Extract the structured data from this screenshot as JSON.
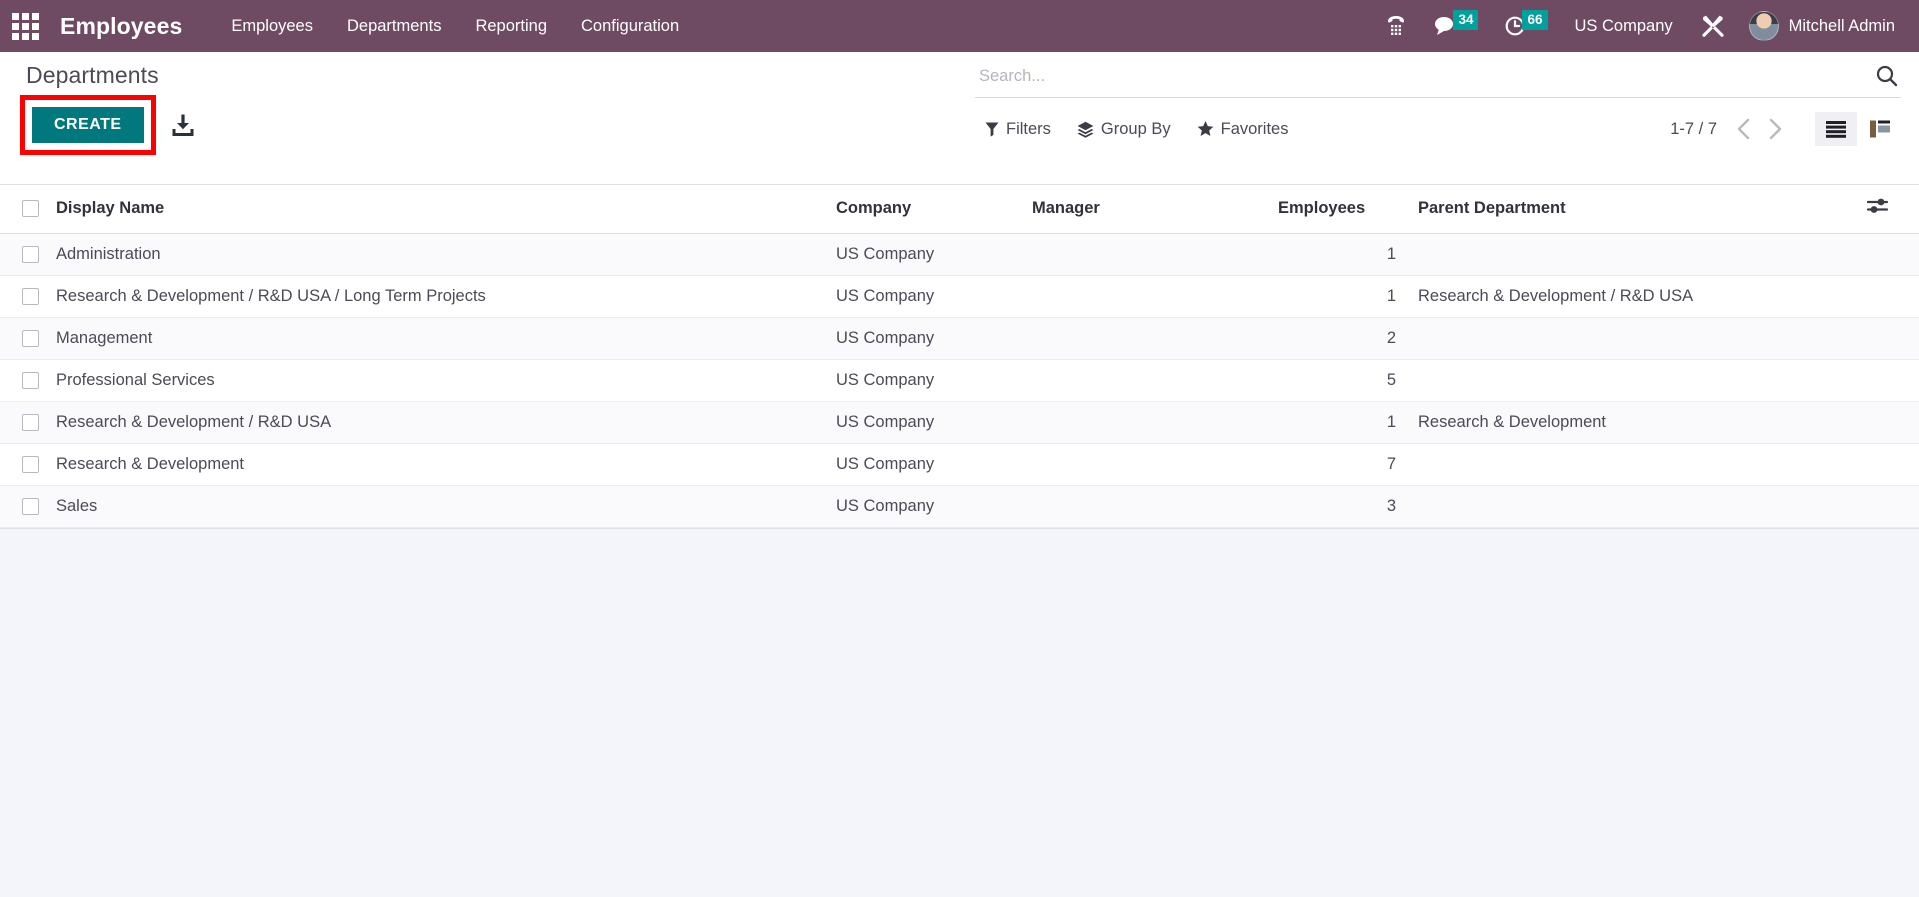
{
  "navbar": {
    "apps_icon": "apps-grid-icon",
    "brand": "Employees",
    "menu": [
      {
        "label": "Employees"
      },
      {
        "label": "Departments"
      },
      {
        "label": "Reporting"
      },
      {
        "label": "Configuration"
      }
    ],
    "voip_icon": "phone-keypad-icon",
    "messages": {
      "icon": "chat-bubble-icon",
      "count": "34"
    },
    "activities": {
      "icon": "clock-icon",
      "count": "66"
    },
    "company": "US Company",
    "settings_icon": "tools-icon",
    "user": {
      "name": "Mitchell Admin",
      "avatar": "user-avatar"
    },
    "bg_color": "#6f4b63",
    "badge_color": "#00a09d"
  },
  "control_panel": {
    "title": "Departments",
    "create_label": "CREATE",
    "create_color": "#00787e",
    "highlight_color": "#ff0000",
    "export_icon": "download-export-icon",
    "search": {
      "placeholder": "Search...",
      "value": "",
      "icon": "search-icon"
    },
    "filters": [
      {
        "label": "Filters",
        "icon": "filter-funnel-icon"
      },
      {
        "label": "Group By",
        "icon": "layers-icon"
      },
      {
        "label": "Favorites",
        "icon": "star-icon"
      }
    ],
    "pager": {
      "range": "1-7 / 7",
      "prev_icon": "chevron-left-icon",
      "next_icon": "chevron-right-icon"
    },
    "views": [
      {
        "name": "list",
        "icon": "list-view-icon",
        "active": true
      },
      {
        "name": "kanban",
        "icon": "kanban-view-icon",
        "active": false
      }
    ]
  },
  "table": {
    "columns": [
      "Display Name",
      "Company",
      "Manager",
      "Employees",
      "Parent Department"
    ],
    "optional_columns_icon": "sliders-icon",
    "rows": [
      {
        "display_name": "Administration",
        "company": "US Company",
        "manager": "",
        "employees": "1",
        "parent_department": ""
      },
      {
        "display_name": "Research & Development / R&D USA / Long Term Projects",
        "company": "US Company",
        "manager": "",
        "employees": "1",
        "parent_department": "Research & Development / R&D USA"
      },
      {
        "display_name": "Management",
        "company": "US Company",
        "manager": "",
        "employees": "2",
        "parent_department": ""
      },
      {
        "display_name": "Professional Services",
        "company": "US Company",
        "manager": "",
        "employees": "5",
        "parent_department": ""
      },
      {
        "display_name": "Research & Development / R&D USA",
        "company": "US Company",
        "manager": "",
        "employees": "1",
        "parent_department": "Research & Development"
      },
      {
        "display_name": "Research & Development",
        "company": "US Company",
        "manager": "",
        "employees": "7",
        "parent_department": ""
      },
      {
        "display_name": "Sales",
        "company": "US Company",
        "manager": "",
        "employees": "3",
        "parent_department": ""
      }
    ]
  }
}
